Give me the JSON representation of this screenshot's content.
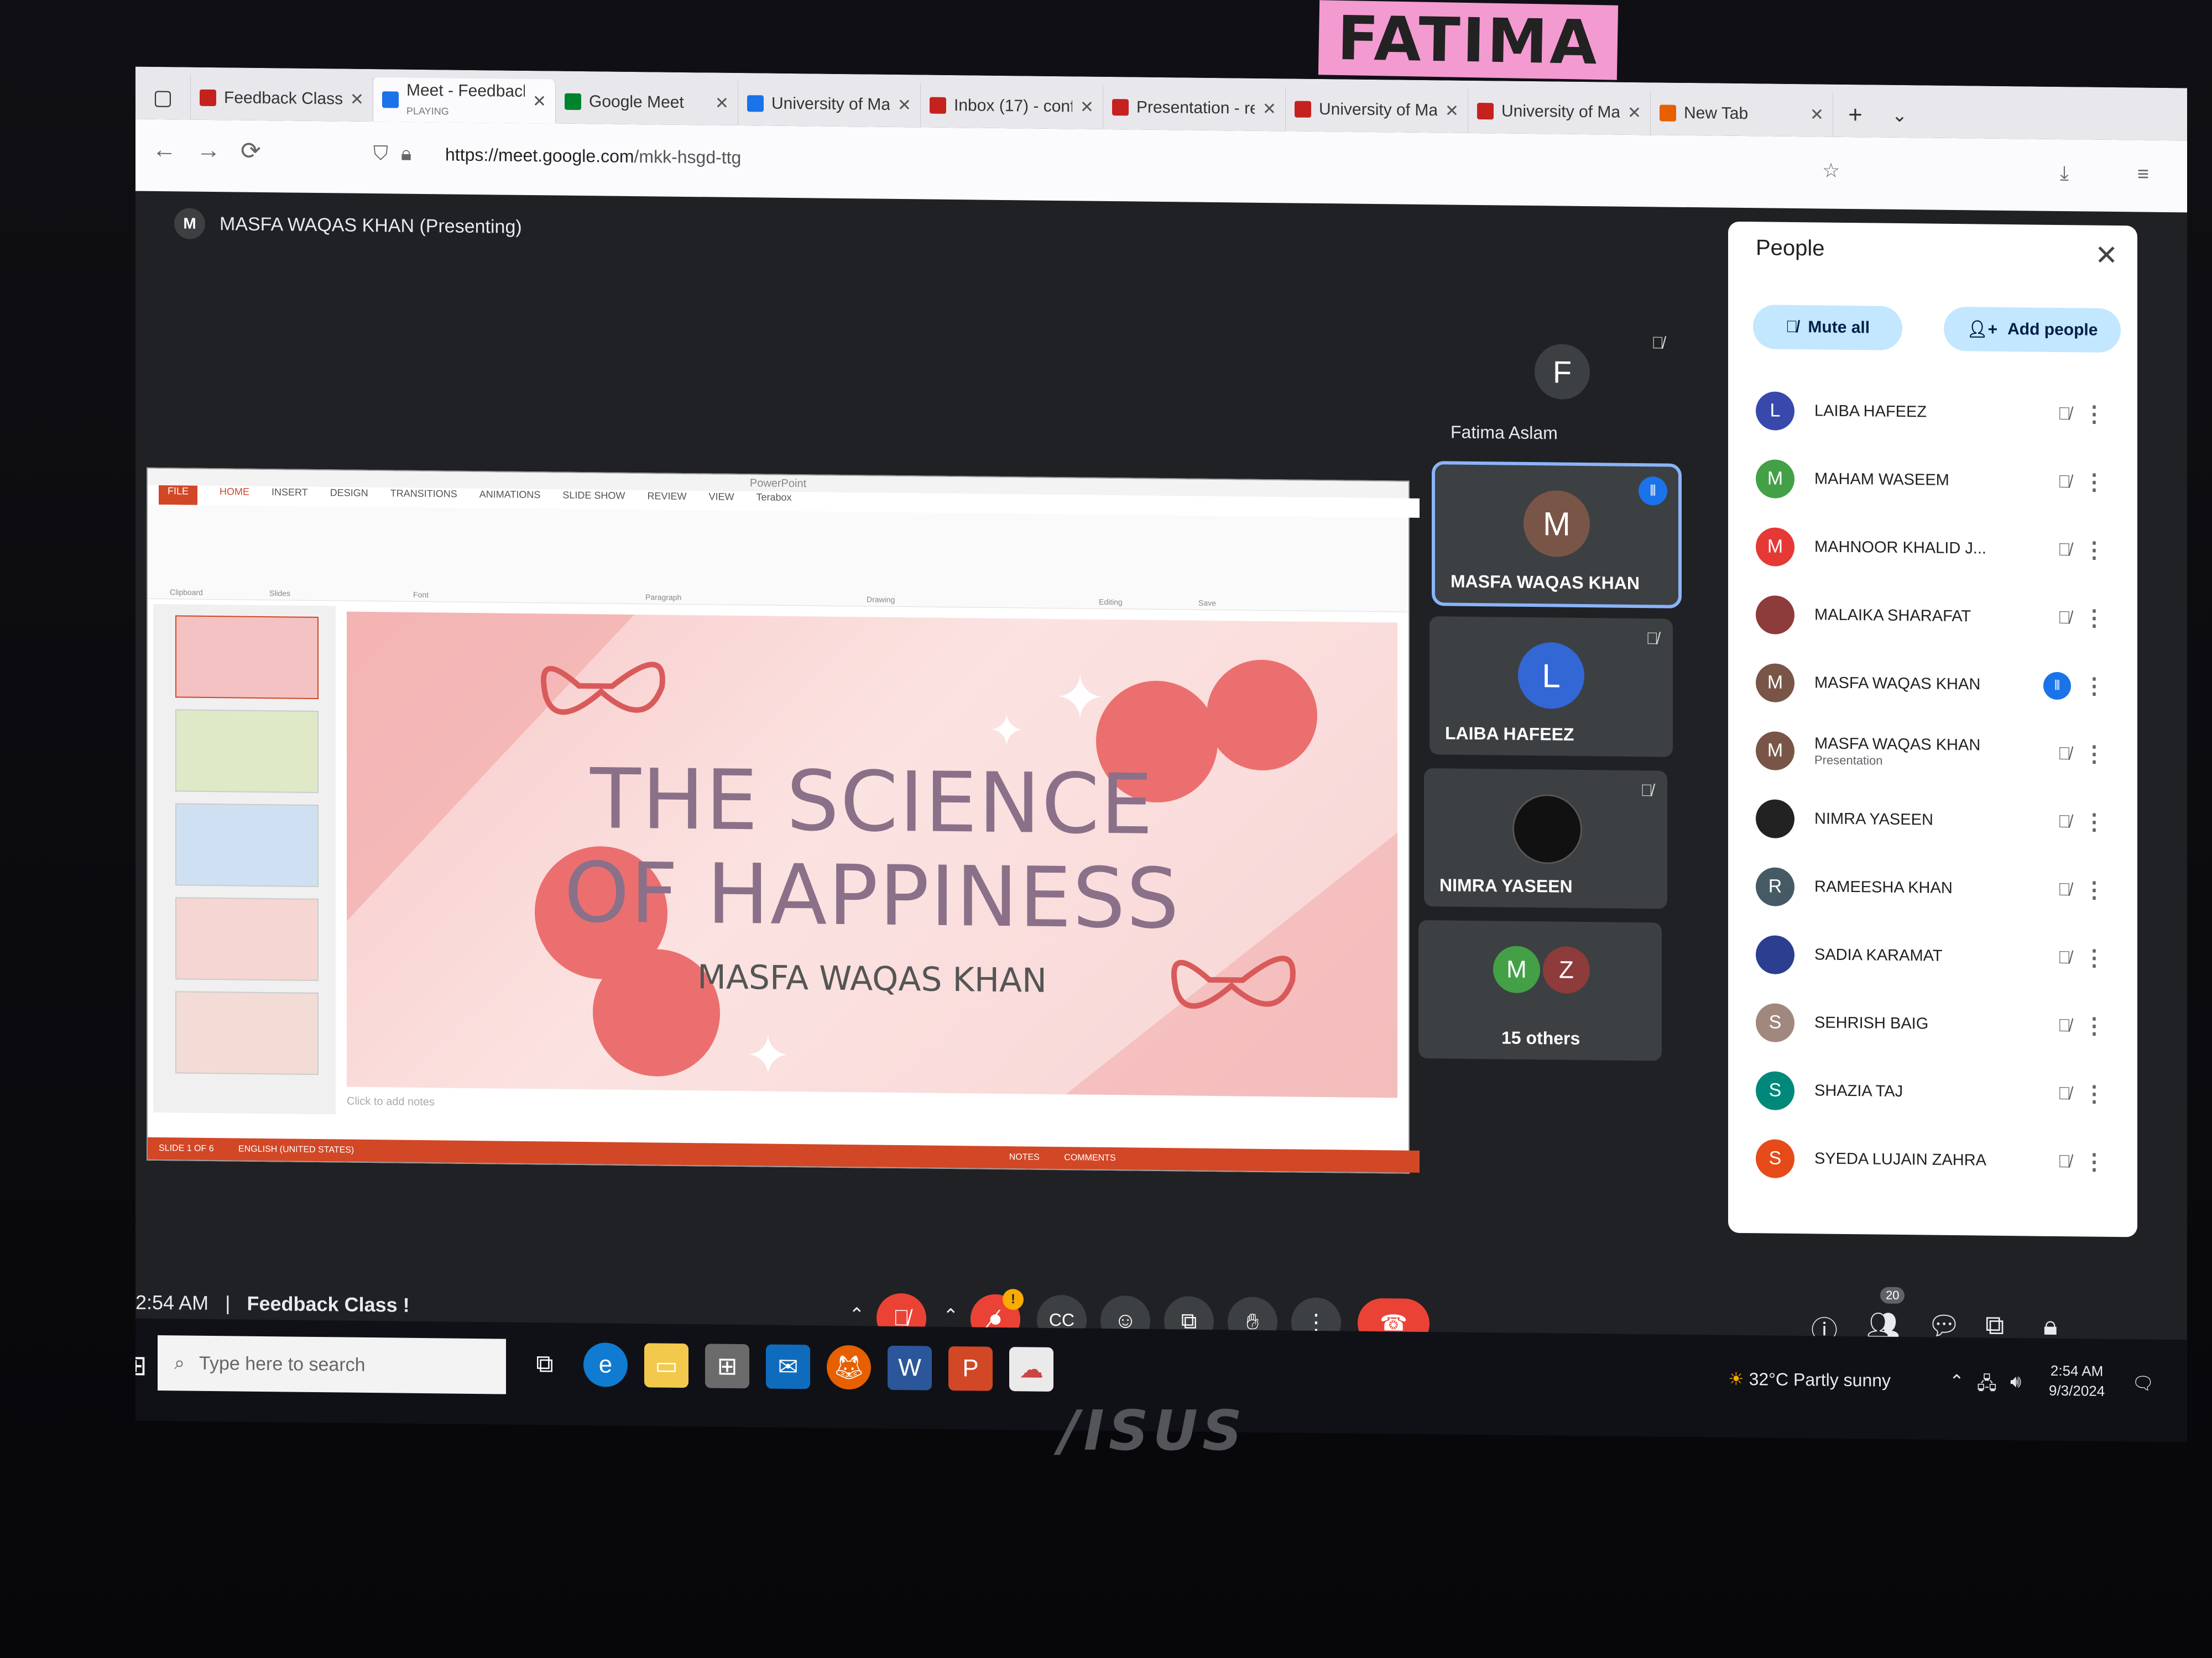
{
  "sticker": {
    "text": "FATIMA"
  },
  "browser": {
    "tabs": [
      {
        "label": "Feedback Class !",
        "favicon": "gmail-icon",
        "color": "#c5221f"
      },
      {
        "label": "Meet - Feedback",
        "status": "PLAYING",
        "favicon": "meet-icon",
        "color": "#1a73e8",
        "active": true
      },
      {
        "label": "Google Meet",
        "favicon": "meet-icon",
        "color": "#00832d"
      },
      {
        "label": "University of Man",
        "favicon": "app-icon",
        "color": "#1a73e8"
      },
      {
        "label": "Inbox (17) - conf",
        "favicon": "gmail-icon",
        "color": "#c5221f"
      },
      {
        "label": "Presentation - rel",
        "favicon": "gmail-icon",
        "color": "#c5221f"
      },
      {
        "label": "University of Man",
        "favicon": "gmail-icon",
        "color": "#c5221f"
      },
      {
        "label": "University of Man",
        "favicon": "gmail-icon",
        "color": "#c5221f"
      },
      {
        "label": "New Tab",
        "favicon": "firefox-icon",
        "color": "#e66000"
      }
    ],
    "url_domain": "https://meet.google.com",
    "url_path": "/mkk-hsgd-ttg"
  },
  "meet": {
    "presenter_initial": "M",
    "presenter_label": "MASFA WAQAS KHAN (Presenting)",
    "clock": "2:54 AM",
    "separator": "|",
    "meeting_name": "Feedback Class !",
    "people_count": "20"
  },
  "slide": {
    "title_line1": "THE SCIENCE",
    "title_line2": "OF HAPPINESS",
    "subtitle": "MASFA WAQAS KHAN",
    "notes_placeholder": "Click to add notes",
    "ribbon_tabs": [
      "FILE",
      "HOME",
      "INSERT",
      "DESIGN",
      "TRANSITIONS",
      "ANIMATIONS",
      "SLIDE SHOW",
      "REVIEW",
      "VIEW",
      "Terabox"
    ],
    "status": "SLIDE 1 OF 6",
    "status_lang": "ENGLISH (UNITED STATES)",
    "status_notes": "NOTES",
    "status_comments": "COMMENTS",
    "ribbon_groups": [
      "Clipboard",
      "Slides",
      "Font",
      "Paragraph",
      "Drawing",
      "Editing",
      "Save"
    ]
  },
  "tiles": [
    {
      "initial": "F",
      "name": "Fatima Aslam",
      "color": "#3c4043",
      "mic": "off"
    },
    {
      "initial": "M",
      "name": "MASFA WAQAS KHAN",
      "color": "#795548",
      "mic": "speaking"
    },
    {
      "initial": "L",
      "name": "LAIBA HAFEEZ",
      "color": "#3367d6",
      "mic": "off"
    },
    {
      "initial": "",
      "name": "NIMRA YASEEN",
      "color": "#111111",
      "mic": "off"
    },
    {
      "initial_a": "M",
      "initial_b": "Z",
      "name": "15 others"
    }
  ],
  "people_panel": {
    "title": "People",
    "mute_all": "Mute all",
    "add_people": "Add people",
    "participants": [
      {
        "initial": "L",
        "name": "LAIBA HAFEEZ",
        "color": "#3949ab",
        "status": "muted"
      },
      {
        "initial": "M",
        "name": "MAHAM WASEEM",
        "color": "#43a047",
        "status": "muted"
      },
      {
        "initial": "M",
        "name": "MAHNOOR KHALID J...",
        "color": "#e53935",
        "status": "muted"
      },
      {
        "initial": "",
        "name": "MALAIKA SHARAFAT",
        "color": "#8d3b3b",
        "status": "muted"
      },
      {
        "initial": "M",
        "name": "MASFA WAQAS KHAN",
        "color": "#795548",
        "status": "speaking"
      },
      {
        "initial": "M",
        "name": "MASFA WAQAS KHAN",
        "sub": "Presentation",
        "color": "#795548",
        "status": "muted"
      },
      {
        "initial": "",
        "name": "NIMRA YASEEN",
        "color": "#222222",
        "status": "muted"
      },
      {
        "initial": "R",
        "name": "RAMEESHA KHAN",
        "color": "#455a64",
        "status": "muted"
      },
      {
        "initial": "",
        "name": "SADIA KARAMAT",
        "color": "#2c3e8f",
        "status": "muted"
      },
      {
        "initial": "S",
        "name": "SEHRISH BAIG",
        "color": "#a1887f",
        "status": "muted"
      },
      {
        "initial": "S",
        "name": "SHAZIA TAJ",
        "color": "#00897b",
        "status": "muted"
      },
      {
        "initial": "S",
        "name": "SYEDA LUJAIN ZAHRA",
        "color": "#e64a19",
        "status": "muted"
      }
    ]
  },
  "taskbar": {
    "search_placeholder": "Type here to search",
    "weather": "32°C  Partly sunny",
    "time": "2:54 AM",
    "date": "9/3/2024"
  },
  "monitor": {
    "brand": "/ISUS"
  }
}
